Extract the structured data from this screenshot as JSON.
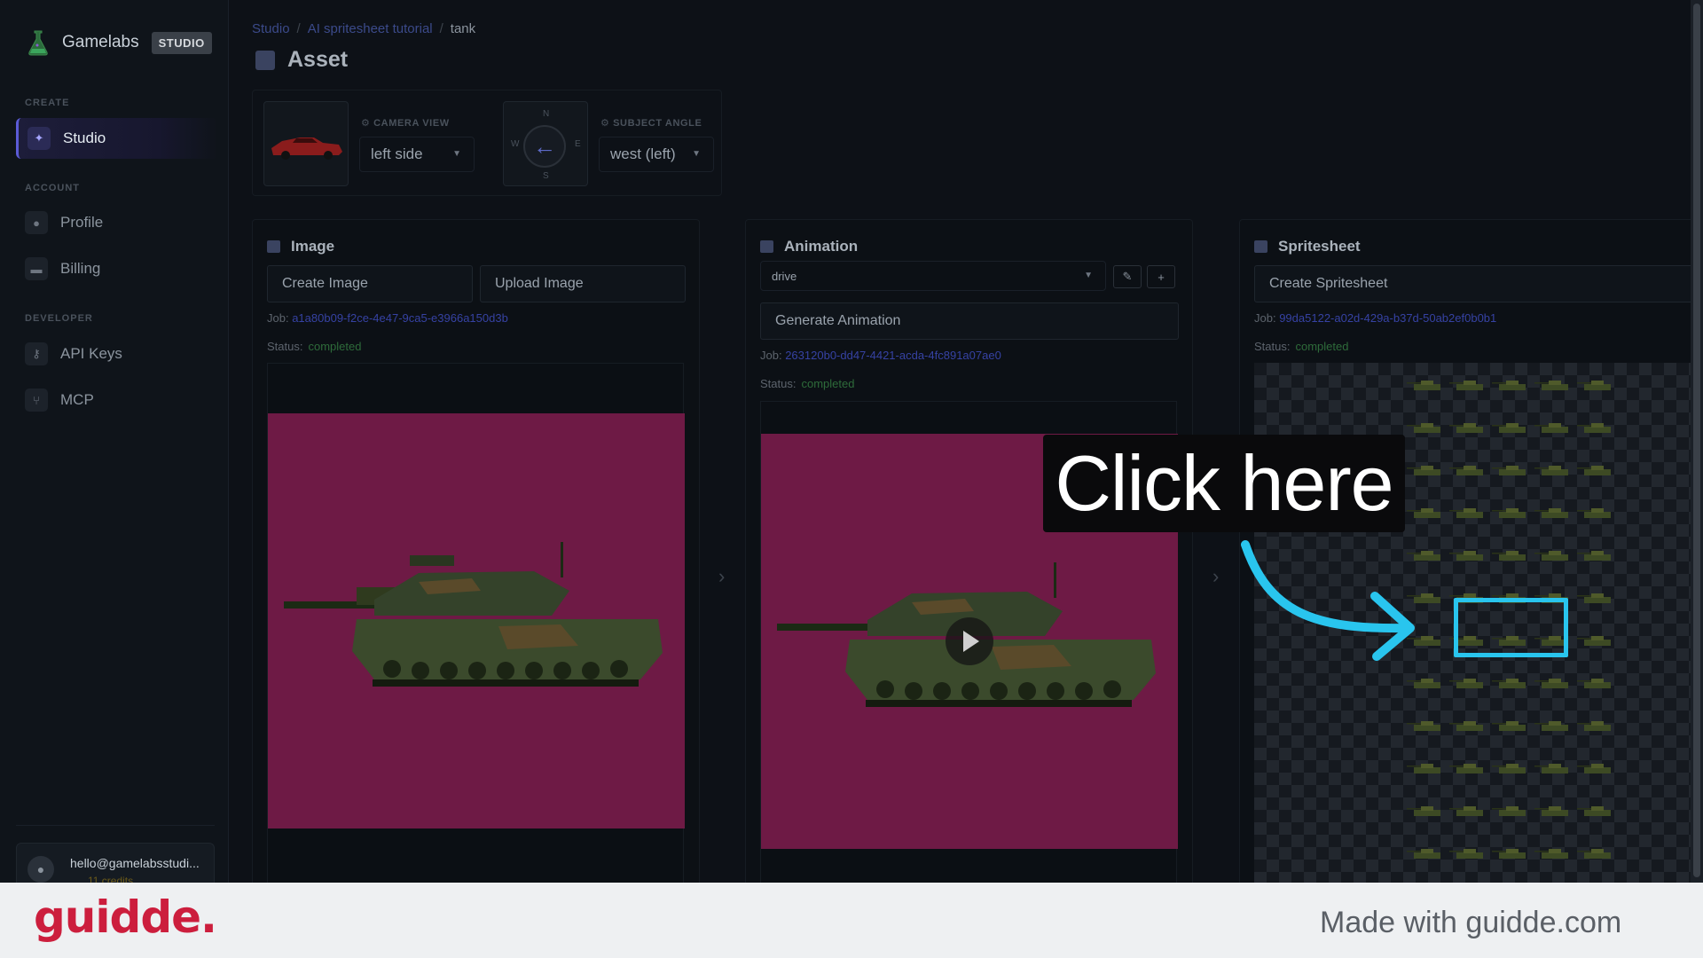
{
  "sidebar": {
    "logo_name": "Gamelabs",
    "logo_badge": "STUDIO",
    "sections": {
      "create": "CREATE",
      "account": "ACCOUNT",
      "developer": "DEVELOPER"
    },
    "items": [
      {
        "label": "Studio",
        "icon": "wand-icon"
      },
      {
        "label": "Profile",
        "icon": "user-icon"
      },
      {
        "label": "Billing",
        "icon": "card-icon"
      },
      {
        "label": "API Keys",
        "icon": "key-icon"
      },
      {
        "label": "MCP",
        "icon": "branch-icon"
      }
    ],
    "user_email": "hello@gamelabsstudi...",
    "user_credits": "11 credits"
  },
  "breadcrumb": {
    "items": [
      "Studio",
      "AI spritesheet tutorial"
    ],
    "current": "tank"
  },
  "page_title": "Asset",
  "toolbar": {
    "camera_view_label": "CAMERA VIEW",
    "camera_view_value": "left side",
    "subject_angle_label": "SUBJECT ANGLE",
    "subject_angle_value": "west (left)",
    "compass": {
      "n": "N",
      "s": "S",
      "e": "E",
      "w": "W"
    }
  },
  "panels": {
    "image": {
      "title": "Image",
      "create_label": "Create Image",
      "upload_label": "Upload Image",
      "job_label": "Job:",
      "job_id": "a1a80b09-f2ce-4e47-9ca5-e3966a150d3b",
      "status_label": "Status:",
      "status_value": "completed"
    },
    "animation": {
      "title": "Animation",
      "select_value": "drive",
      "generate_label": "Generate Animation",
      "job_label": "Job:",
      "job_id": "263120b0-dd47-4421-acda-4fc891a07ae0",
      "status_label": "Status:",
      "status_value": "completed"
    },
    "spritesheet": {
      "title": "Spritesheet",
      "create_label": "Create Spritesheet",
      "job_label": "Job:",
      "job_id": "99da5122-a02d-429a-b37d-50ab2ef0b0b1",
      "status_label": "Status:",
      "status_value": "completed"
    }
  },
  "callout": {
    "text": "Click here"
  },
  "footer": {
    "brand": "guidde.",
    "made_with": "Made with guidde.com"
  },
  "colors": {
    "accent": "#5b5bd6",
    "callout_highlight": "#29c5ee",
    "magenta_bg": "#6e1a45",
    "brand_red": "#cc1e3d"
  }
}
